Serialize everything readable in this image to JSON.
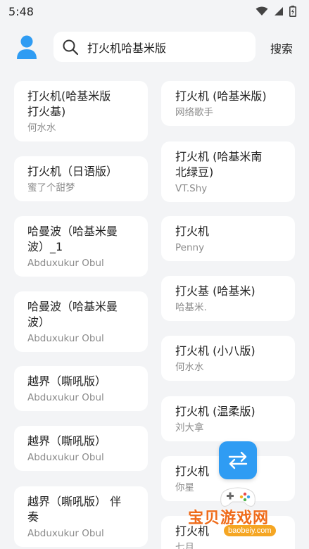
{
  "status_bar": {
    "time": "5:48"
  },
  "search": {
    "query": "打火机哈基米版",
    "button_label": "搜索"
  },
  "colors": {
    "accent": "#2f9cf3",
    "background": "#f3f4f6",
    "card": "#ffffff",
    "subtext": "#8b8b8b",
    "watermark": "#ef6b1a"
  },
  "songs_left": [
    {
      "title_lines": [
        "打火机(哈基米版",
        "打火基)"
      ],
      "artist": "何水水"
    },
    {
      "title_lines": [
        "打火机（日语版）"
      ],
      "artist": "蜜了个甜梦"
    },
    {
      "title_lines": [
        "哈曼波（哈基米曼",
        "波）_1"
      ],
      "artist": "Abduxukur Obul"
    },
    {
      "title_lines": [
        "哈曼波（哈基米曼",
        "波）"
      ],
      "artist": "Abduxukur Obul"
    },
    {
      "title_lines": [
        "越界（嘶吼版）"
      ],
      "artist": "Abduxukur Obul"
    },
    {
      "title_lines": [
        "越界（嘶吼版）"
      ],
      "artist": "Abduxukur Obul"
    },
    {
      "title_lines": [
        "越界（嘶吼版） 伴",
        "奏"
      ],
      "artist": "Abduxukur Obul"
    }
  ],
  "songs_right": [
    {
      "title_lines": [
        "打火机 (哈基米版)"
      ],
      "artist": "网络歌手"
    },
    {
      "title_lines": [
        "打火机 (哈基米南",
        "北绿豆)"
      ],
      "artist": "VT.Shy"
    },
    {
      "title_lines": [
        "打火机"
      ],
      "artist": "Penny"
    },
    {
      "title_lines": [
        "打火基 (哈基米)"
      ],
      "artist": "哈基米."
    },
    {
      "title_lines": [
        "打火机 (小八版)"
      ],
      "artist": "何水水"
    },
    {
      "title_lines": [
        "打火机 (温柔版)"
      ],
      "artist": "刘大拿"
    },
    {
      "title_lines": [
        "打火机"
      ],
      "artist": "你星"
    },
    {
      "title_lines": [
        "打火机"
      ],
      "artist": "七月"
    }
  ],
  "watermark": {
    "text": "宝贝游戏网",
    "url": "baobeiy.com"
  }
}
